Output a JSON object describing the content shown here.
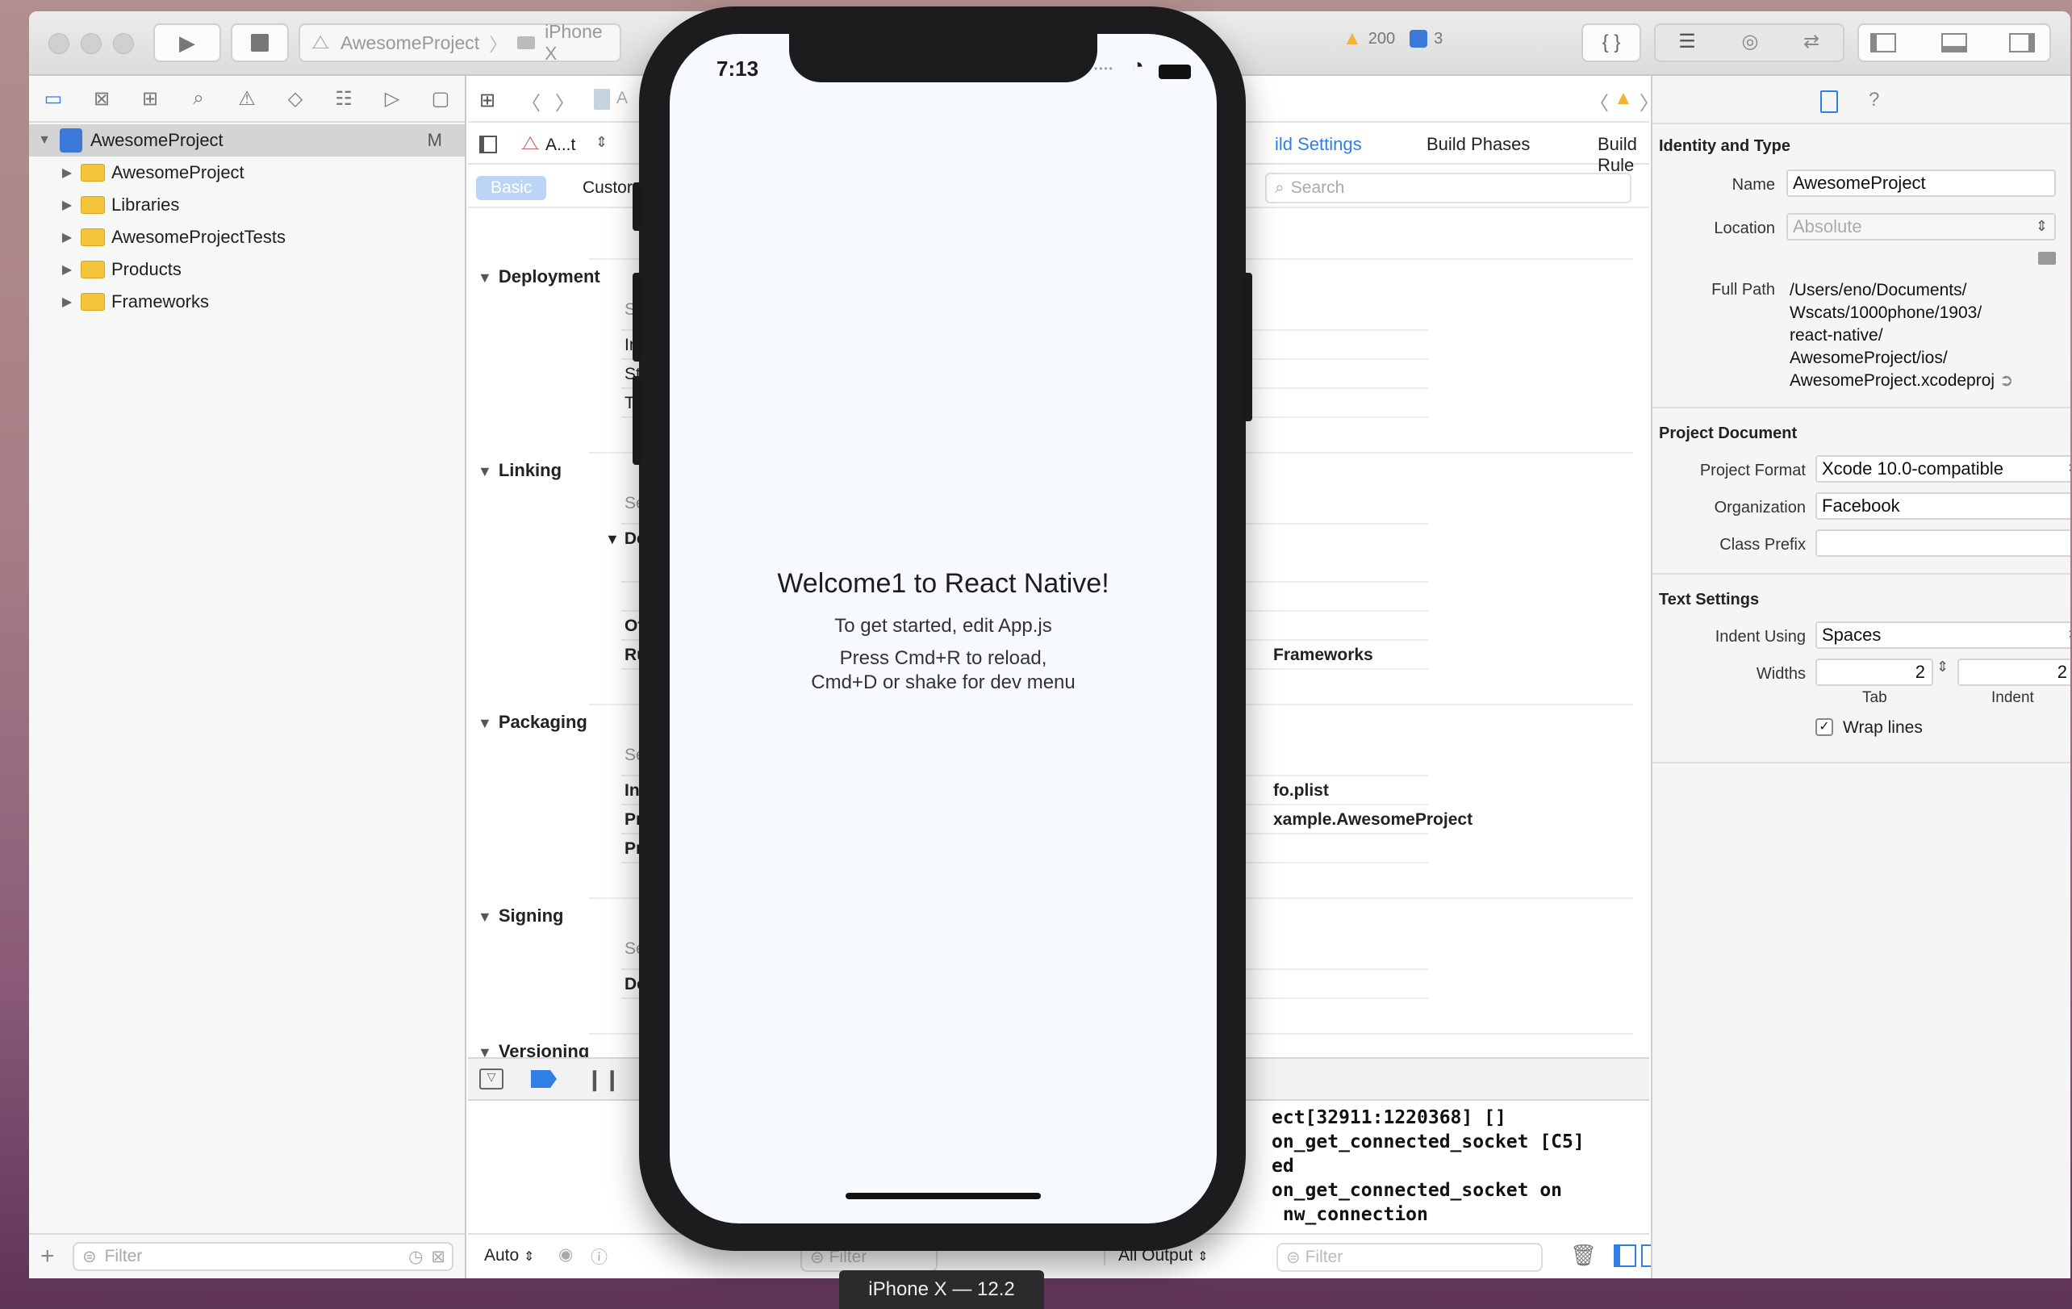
{
  "toolbar": {
    "scheme_project": "AwesomeProject",
    "scheme_device": "iPhone X",
    "warnings_count": "200",
    "issues_count": "3"
  },
  "navigator": {
    "root": {
      "label": "AwesomeProject",
      "badge": "M"
    },
    "items": [
      {
        "label": "AwesomeProject"
      },
      {
        "label": "Libraries"
      },
      {
        "label": "AwesomeProjectTests"
      },
      {
        "label": "Products"
      },
      {
        "label": "Frameworks"
      }
    ],
    "filter_placeholder": "Filter"
  },
  "editor": {
    "jumpbar_partial": "A",
    "target_name": "A...t",
    "tabs": {
      "build_settings": "ild Settings",
      "build_phases": "Build Phases",
      "build_rules": "Build Rule"
    },
    "filter_basic": "Basic",
    "filter_customized": "Custor",
    "search_placeholder": "Search",
    "sections": {
      "deployment": {
        "title": "Deployment",
        "col": "Setti",
        "rows": [
          "Insta",
          "Strip",
          "Targ"
        ]
      },
      "linking": {
        "title": "Linking",
        "col": "Settir",
        "rows": [
          "Dead",
          "Othe",
          "Runp"
        ],
        "runp_value": "Frameworks"
      },
      "packaging": {
        "title": "Packaging",
        "col": "Settir",
        "rows": [
          "Info.p",
          "Produ",
          "Produ"
        ],
        "info_value": "fo.plist",
        "produ_value": "xample.AwesomeProject"
      },
      "signing": {
        "title": "Signing",
        "col": "Settir",
        "rows": [
          "Deve"
        ]
      },
      "versioning": {
        "title": "Versioning"
      }
    },
    "console_lines": [
      "ect[32911:1220368] []",
      "on_get_connected_socket [C5]",
      "ed",
      "on_get_connected_socket on",
      " nw_connection"
    ],
    "footer": {
      "auto_label": "Auto",
      "filter_placeholder": "Filter",
      "output_label": "All Output",
      "console_filter_placeholder": "Filter"
    }
  },
  "inspector": {
    "identity_title": "Identity and Type",
    "name_label": "Name",
    "name_value": "AwesomeProject",
    "location_label": "Location",
    "location_value": "Absolute",
    "fullpath_label": "Full Path",
    "fullpath_lines": [
      "/Users/eno/Documents/",
      "Wscats/1000phone/1903/",
      "react-native/",
      "AwesomeProject/ios/",
      "AwesomeProject.xcodeproj"
    ],
    "project_doc_title": "Project Document",
    "format_label": "Project Format",
    "format_value": "Xcode 10.0-compatible",
    "org_label": "Organization",
    "org_value": "Facebook",
    "prefix_label": "Class Prefix",
    "prefix_value": "",
    "text_settings_title": "Text Settings",
    "indent_label": "Indent Using",
    "indent_value": "Spaces",
    "widths_label": "Widths",
    "tab_value": "2",
    "indent_width_value": "2",
    "tab_caption": "Tab",
    "indent_caption": "Indent",
    "wrap_label": "Wrap lines",
    "wrap_checked": true
  },
  "simulator": {
    "time": "7:13",
    "welcome_title": "Welcome1 to React Native!",
    "line1": "To get started, edit App.js",
    "line2": "Press Cmd+R to reload,",
    "line3": "Cmd+D or shake for dev menu",
    "device_label": "iPhone X — 12.2"
  },
  "colors": {
    "accent": "#2f7fe6",
    "folder": "#f4c43a",
    "warning": "#f2b233"
  }
}
